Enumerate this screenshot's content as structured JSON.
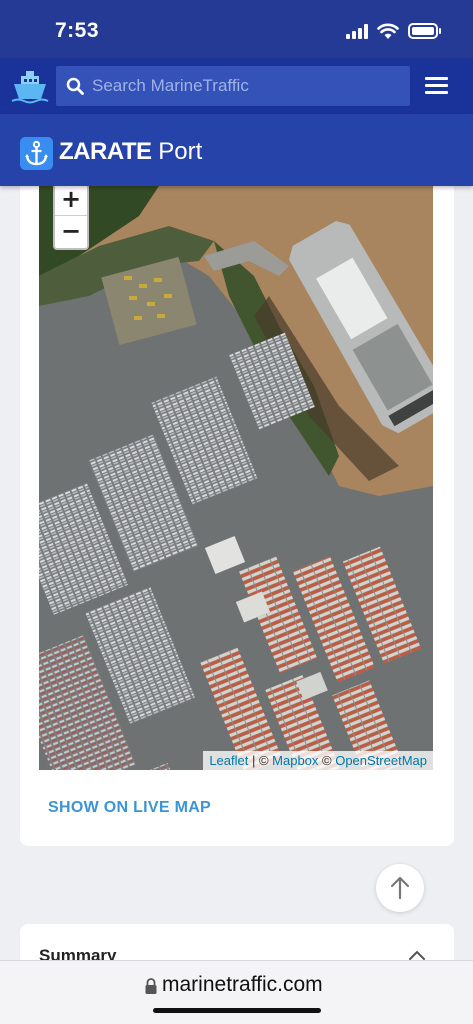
{
  "status": {
    "time": "7:53"
  },
  "nav": {
    "search_placeholder": "Search MarineTraffic"
  },
  "port": {
    "name_bold": "ZARATE",
    "name_rest": "Port"
  },
  "map": {
    "zoom_in": "+",
    "zoom_out": "−",
    "attribution": {
      "leaflet": "Leaflet",
      "sep1": " | © ",
      "mapbox": "Mapbox",
      "sep2": " © ",
      "osm": "OpenStreetMap"
    }
  },
  "card": {
    "show_live_map": "SHOW ON LIVE MAP"
  },
  "summary": {
    "title": "Summary"
  },
  "browser": {
    "url": "marinetraffic.com"
  },
  "colors": {
    "header_blue": "#19339a",
    "port_blue": "#2543a8",
    "link_blue": "#3d94d4",
    "river": "#a8855f"
  }
}
